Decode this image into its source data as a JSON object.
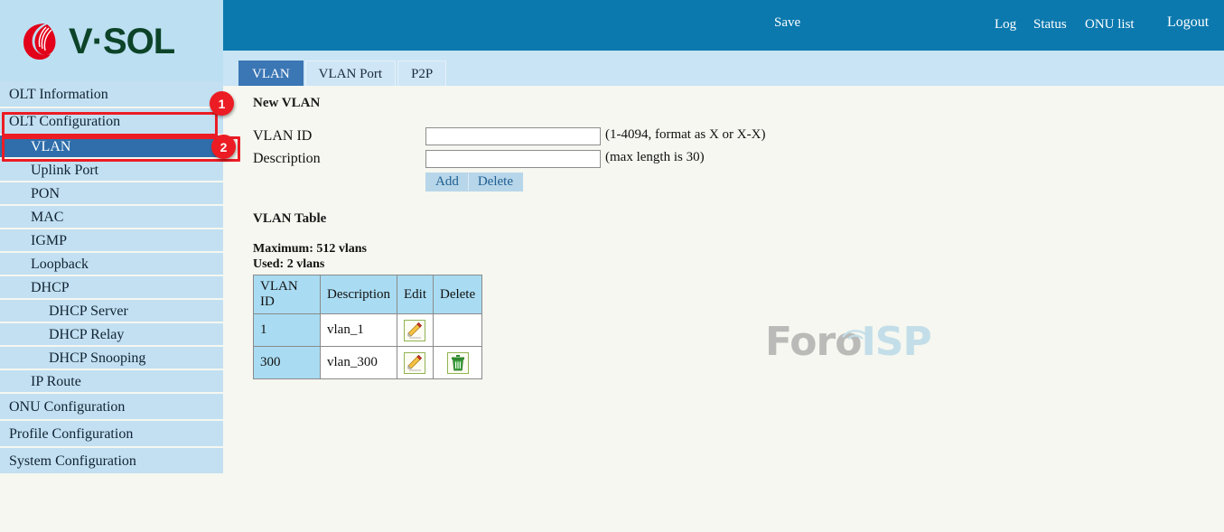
{
  "brand": {
    "name": "V·SOL",
    "logo_icon": "vsol-spiral-logo",
    "logo_color": "#e2001a",
    "text_color": "#0d4429"
  },
  "header": {
    "background": "#0b79ae",
    "save_label": "Save",
    "status_dot_icon": "status-dot-icon",
    "status_dot_color": "#a8cd3a",
    "links": [
      {
        "label": "Log"
      },
      {
        "label": "Status"
      },
      {
        "label": "ONU list"
      },
      {
        "label": "Logout"
      }
    ]
  },
  "tabs": [
    {
      "label": "VLAN",
      "active": true
    },
    {
      "label": "VLAN Port",
      "active": false
    },
    {
      "label": "P2P",
      "active": false
    }
  ],
  "sidebar": {
    "background": "#c2e0f1",
    "active_color": "#2f6eab",
    "items": [
      {
        "label": "OLT Information",
        "level": 0,
        "active": false
      },
      {
        "label": "OLT Configuration",
        "level": 0,
        "active": false
      },
      {
        "label": "VLAN",
        "level": 1,
        "active": true
      },
      {
        "label": "Uplink Port",
        "level": 1,
        "active": false
      },
      {
        "label": "PON",
        "level": 1,
        "active": false
      },
      {
        "label": "MAC",
        "level": 1,
        "active": false
      },
      {
        "label": "IGMP",
        "level": 1,
        "active": false
      },
      {
        "label": "Loopback",
        "level": 1,
        "active": false
      },
      {
        "label": "DHCP",
        "level": 1,
        "active": false
      },
      {
        "label": "DHCP Server",
        "level": 2,
        "active": false
      },
      {
        "label": "DHCP Relay",
        "level": 2,
        "active": false
      },
      {
        "label": "DHCP Snooping",
        "level": 2,
        "active": false
      },
      {
        "label": "IP Route",
        "level": 1,
        "active": false
      },
      {
        "label": "ONU Configuration",
        "level": 0,
        "active": false
      },
      {
        "label": "Profile Configuration",
        "level": 0,
        "active": false
      },
      {
        "label": "System Configuration",
        "level": 0,
        "active": false
      }
    ]
  },
  "main": {
    "new_vlan": {
      "title": "New VLAN",
      "vlan_id_label": "VLAN ID",
      "vlan_id_value": "",
      "vlan_id_hint": "(1-4094, format as X or X-X)",
      "description_label": "Description",
      "description_value": "",
      "description_hint": "(max length is 30)",
      "add_label": "Add",
      "delete_label": "Delete"
    },
    "vlan_table": {
      "title": "VLAN Table",
      "maximum_text": "Maximum: 512 vlans",
      "used_text": "Used: 2 vlans",
      "columns": [
        "VLAN ID",
        "Description",
        "Edit",
        "Delete"
      ],
      "rows": [
        {
          "vlan_id": "1",
          "description": "vlan_1",
          "edit_icon": "pencil-edit-icon",
          "delete_icon": ""
        },
        {
          "vlan_id": "300",
          "description": "vlan_300",
          "edit_icon": "pencil-edit-icon",
          "delete_icon": "trash-delete-icon"
        }
      ]
    }
  },
  "watermark": {
    "text_primary": "Foro",
    "text_secondary": "ISP",
    "icon": "wifi-arcs-icon"
  },
  "annotations": [
    {
      "badge": "1",
      "target": "OLT Configuration"
    },
    {
      "badge": "2",
      "target": "VLAN"
    }
  ]
}
